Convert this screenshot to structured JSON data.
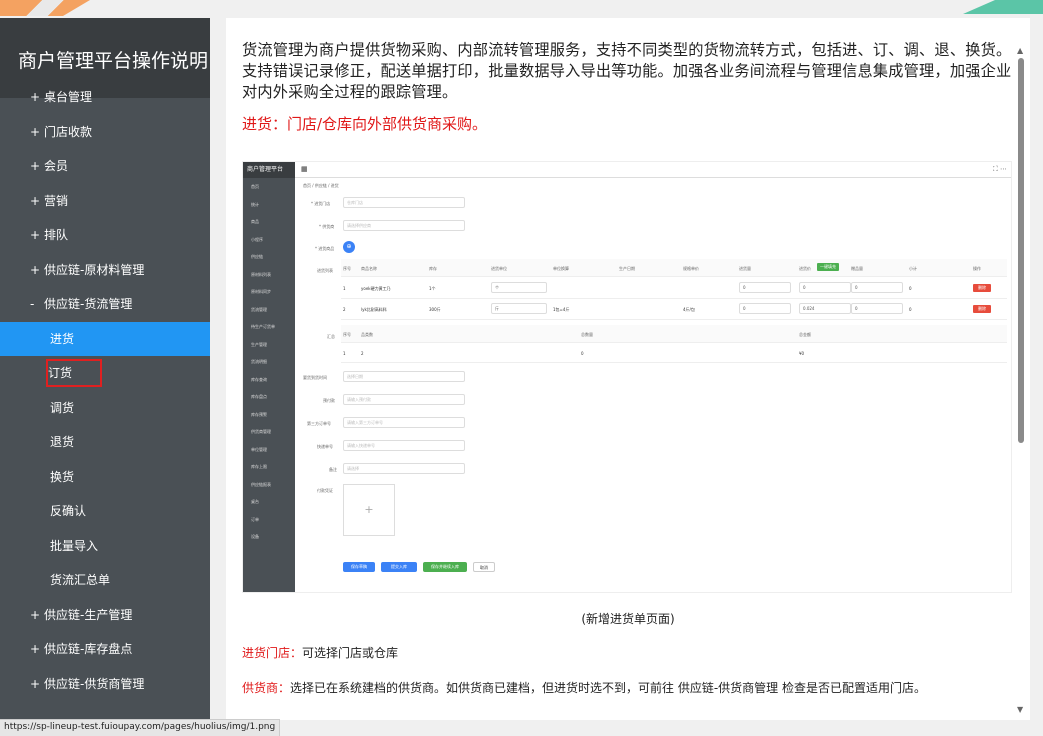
{
  "sidebar": {
    "title": "商户管理平台操作说明",
    "items": [
      {
        "prefix": "+",
        "label": "桌台管理",
        "type": "top"
      },
      {
        "prefix": "+",
        "label": "门店收款",
        "type": "top"
      },
      {
        "prefix": "+",
        "label": "会员",
        "type": "top"
      },
      {
        "prefix": "+",
        "label": "营销",
        "type": "top"
      },
      {
        "prefix": "+",
        "label": "排队",
        "type": "top"
      },
      {
        "prefix": "+",
        "label": "供应链-原材料管理",
        "type": "top"
      },
      {
        "prefix": "-",
        "label": "供应链-货流管理",
        "type": "top"
      },
      {
        "label": "进货",
        "type": "sub",
        "state": "active"
      },
      {
        "label": "订货",
        "type": "sub",
        "state": "boxed"
      },
      {
        "label": "调货",
        "type": "sub"
      },
      {
        "label": "退货",
        "type": "sub"
      },
      {
        "label": "换货",
        "type": "sub"
      },
      {
        "label": "反确认",
        "type": "sub"
      },
      {
        "label": "批量导入",
        "type": "sub"
      },
      {
        "label": "货流汇总单",
        "type": "sub"
      },
      {
        "prefix": "+",
        "label": "供应链-生产管理",
        "type": "top"
      },
      {
        "prefix": "+",
        "label": "供应链-库存盘点",
        "type": "top"
      },
      {
        "prefix": "+",
        "label": "供应链-供货商管理",
        "type": "top"
      }
    ]
  },
  "content": {
    "intro": "货流管理为商户提供货物采购、内部流转管理服务，支持不同类型的货物流转方式，包括进、订、调、退、换货。支持错误记录修正，配送单据打印，批量数据导入导出等功能。加强各业务间流程与管理信息集成管理，加强企业对内外采购全过程的跟踪管理。",
    "section_title": "进货：门店/仓库向外部供货商采购。",
    "caption": "(新增进货单页面)",
    "p1_key": "进货门店：",
    "p1_text": "可选择门店或仓库",
    "p2_key": "供货商：",
    "p2_text": "选择已在系统建档的供货商。如供货商已建档，但进货时选不到，可前往 供应链-供货商管理 检查是否已配置适用门店。"
  },
  "embedded": {
    "brand": "商户管理平台",
    "breadcrumb": "首页 / 供应链 / 进货",
    "menu": [
      "首页",
      "统计",
      "商品",
      "小程序",
      "供应链",
      "原材料列表",
      "原材料同步",
      "货流管理",
      "待生产订货单",
      "生产管理",
      "货流明细",
      "库存查询",
      "库存盘点",
      "库存预警",
      "供货商管理",
      "单位管理",
      "库存上限",
      "供应链报表",
      "桌台",
      "订单",
      "设备"
    ],
    "form": {
      "store_label": "* 进货门店",
      "store_ph": "仓库门店",
      "supplier_label": "* 供货商",
      "supplier_ph": "请选择供应商",
      "goods_label": "* 进货商品",
      "list_label": "进货列表",
      "summary_label": "汇总",
      "date_label": "要货到货时间",
      "date_ph": "选择日期",
      "pay_label": "预付款",
      "pay_ph": "请输入预付款",
      "third_label": "第三方订单号",
      "third_ph": "请输入第三方订单号",
      "express_label": "快递单号",
      "express_ph": "请输入快递单号",
      "remark_label": "备注",
      "remark_ph": "请选择",
      "voucher_label": "付款凭证"
    },
    "table_headers": [
      "序号",
      "商品名称",
      "库存",
      "进货单位",
      "单位换算",
      "生产日期",
      "规格单价",
      "进货量",
      "进货价",
      "赠品量",
      "小计",
      "操作"
    ],
    "rows": [
      [
        "1",
        "yoek硬力黄工乃",
        "1个",
        "个",
        "",
        "",
        "",
        "0",
        "0",
        "0",
        "0",
        "删除"
      ],
      [
        "2",
        "lyk比耐高料科",
        "300斤",
        "斤",
        "1包=4斤",
        "",
        "4斤/包",
        "0",
        "0.024",
        "0",
        "0",
        "删除"
      ]
    ],
    "summary_headers": [
      "序号",
      "品类数",
      "总数量",
      "总金额"
    ],
    "summary_row": [
      "1",
      "2",
      "0",
      "¥0"
    ],
    "buttons": [
      "保存草稿",
      "提交入库",
      "保存并继续入库",
      "取消"
    ]
  },
  "statusbar": "https://sp-lineup-test.fuioupay.com/pages/huolius/img/1.png"
}
